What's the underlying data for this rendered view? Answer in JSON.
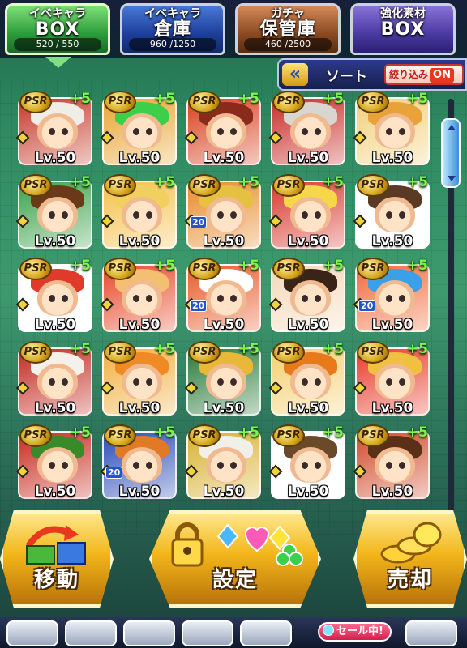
{
  "tabs": [
    {
      "line1": "イベキャラ",
      "line2": "BOX",
      "count": "520 / 550",
      "active": true
    },
    {
      "line1": "イベキャラ",
      "line2": "倉庫",
      "count": "960 /1250",
      "active": false
    },
    {
      "line1": "ガチャ",
      "line2": "保管庫",
      "count": "460 /2500",
      "active": false
    },
    {
      "line1": "強化素材",
      "line2": "BOX",
      "count": "",
      "active": false
    }
  ],
  "sortbar": {
    "chevron": "«",
    "sort_label": "ソート",
    "filter_label": "絞り込み",
    "filter_state": "ON"
  },
  "cards": [
    {
      "rarity": "PSR",
      "bonus": "+5",
      "level": "Lv.50",
      "hair": "#f0ece6",
      "bg": "#c63a2a",
      "badge": ""
    },
    {
      "rarity": "PSR",
      "bonus": "+5",
      "level": "Lv.50",
      "hair": "#3ccf4a",
      "bg": "#e8a532",
      "badge": ""
    },
    {
      "rarity": "PSR",
      "bonus": "+5",
      "level": "Lv.50",
      "hair": "#8a2a1a",
      "bg": "#d8401e",
      "badge": ""
    },
    {
      "rarity": "PSR",
      "bonus": "+5",
      "level": "Lv.50",
      "hair": "#d8d6d0",
      "bg": "#c82c28",
      "badge": ""
    },
    {
      "rarity": "PSR",
      "bonus": "+5",
      "level": "Lv.50",
      "hair": "#e8a23a",
      "bg": "#f2d07a",
      "badge": ""
    },
    {
      "rarity": "PSR",
      "bonus": "+5",
      "level": "Lv.50",
      "hair": "#6a3a18",
      "bg": "#3aa24a",
      "badge": ""
    },
    {
      "rarity": "PSR",
      "bonus": "+5",
      "level": "Lv.50",
      "hair": "#f2d060",
      "bg": "#f5c04a",
      "badge": ""
    },
    {
      "rarity": "PSR",
      "bonus": "+5",
      "level": "Lv.50",
      "hair": "#e6c040",
      "bg": "#e88a2a",
      "badge": "20"
    },
    {
      "rarity": "PSR",
      "bonus": "+5",
      "level": "Lv.50",
      "hair": "#f4d84a",
      "bg": "#d83a30",
      "badge": ""
    },
    {
      "rarity": "PSR",
      "bonus": "+5",
      "level": "Lv.50",
      "hair": "#5a3a24",
      "bg": "#ffffff",
      "badge": ""
    },
    {
      "rarity": "PSR",
      "bonus": "+5",
      "level": "Lv.50",
      "hair": "#e03a2a",
      "bg": "#ffffff",
      "badge": ""
    },
    {
      "rarity": "PSR",
      "bonus": "+5",
      "level": "Lv.50",
      "hair": "#f2c070",
      "bg": "#e8482a",
      "badge": ""
    },
    {
      "rarity": "PSR",
      "bonus": "+5",
      "level": "Lv.50",
      "hair": "#ffffff",
      "bg": "#e85a2a",
      "badge": "20"
    },
    {
      "rarity": "PSR",
      "bonus": "+5",
      "level": "Lv.50",
      "hair": "#3a2418",
      "bg": "#f4d8b8",
      "badge": ""
    },
    {
      "rarity": "PSR",
      "bonus": "+5",
      "level": "Lv.50",
      "hair": "#3aa0e8",
      "bg": "#f26a3a",
      "badge": "20"
    },
    {
      "rarity": "PSR",
      "bonus": "+5",
      "level": "Lv.50",
      "hair": "#f4f0ea",
      "bg": "#c22a22",
      "badge": ""
    },
    {
      "rarity": "PSR",
      "bonus": "+5",
      "level": "Lv.50",
      "hair": "#f08a24",
      "bg": "#f2b040",
      "badge": ""
    },
    {
      "rarity": "PSR",
      "bonus": "+5",
      "level": "Lv.50",
      "hair": "#e8b838",
      "bg": "#2a7a3a",
      "badge": ""
    },
    {
      "rarity": "PSR",
      "bonus": "+5",
      "level": "Lv.50",
      "hair": "#e87a1c",
      "bg": "#f5d070",
      "badge": ""
    },
    {
      "rarity": "PSR",
      "bonus": "+5",
      "level": "Lv.50",
      "hair": "#f2c040",
      "bg": "#e83a2a",
      "badge": ""
    },
    {
      "rarity": "PSR",
      "bonus": "+5",
      "level": "Lv.50",
      "hair": "#3a8a2a",
      "bg": "#c82a1e",
      "badge": ""
    },
    {
      "rarity": "PSR",
      "bonus": "+5",
      "level": "Lv.50",
      "hair": "#e07a24",
      "bg": "#2a4ab8",
      "badge": "20"
    },
    {
      "rarity": "PSR",
      "bonus": "+5",
      "level": "Lv.50",
      "hair": "#f0f0e8",
      "bg": "#d8b030",
      "badge": ""
    },
    {
      "rarity": "PSR",
      "bonus": "+5",
      "level": "Lv.50",
      "hair": "#6a4a28",
      "bg": "#ffffff",
      "badge": ""
    },
    {
      "rarity": "PSR",
      "bonus": "+5",
      "level": "Lv.50",
      "hair": "#5a3018",
      "bg": "#d04a2a",
      "badge": ""
    }
  ],
  "actions": {
    "move": "移動",
    "settings": "設定",
    "sell": "売却"
  },
  "bottom": {
    "sale": "セール中!"
  },
  "colors": {
    "accent_green": "#7df54a",
    "tab_active": "#2c9b3a",
    "sort_bar": "#2d3a8a",
    "filter_on": "#e8391f"
  },
  "icons": [
    "chevron-left-icon",
    "lock-icon",
    "move-box-icon",
    "coins-icon",
    "gem-icon"
  ]
}
